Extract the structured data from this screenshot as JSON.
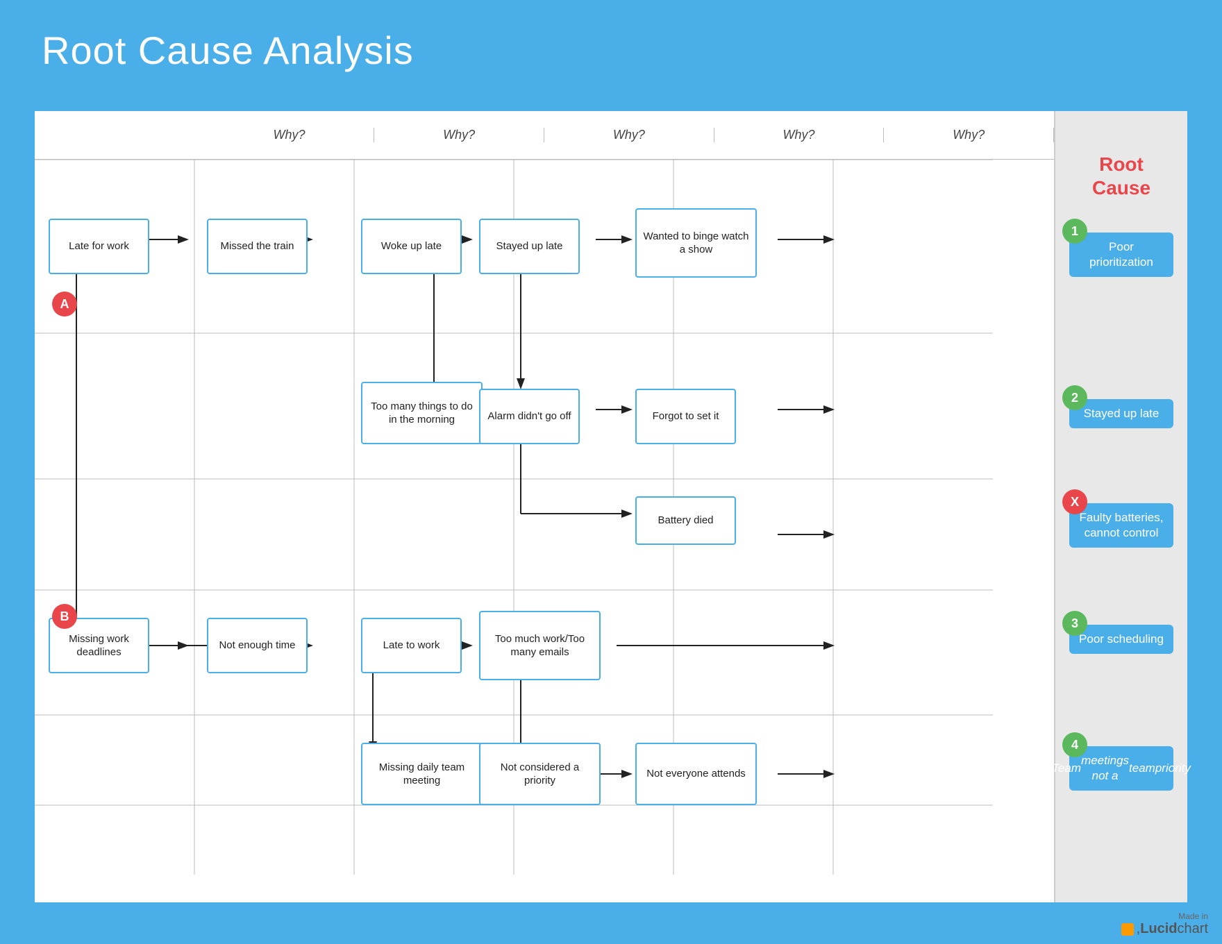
{
  "title": "Root Cause Analysis",
  "header": {
    "why_labels": [
      "Why?",
      "Why?",
      "Why?",
      "Why?",
      "Why?"
    ]
  },
  "row_labels": [
    {
      "id": "A",
      "color": "red"
    },
    {
      "id": "B",
      "color": "red"
    }
  ],
  "boxes": [
    {
      "id": "late-for-work",
      "text": "Late for work",
      "col": 0,
      "row": "A-main"
    },
    {
      "id": "missed-train",
      "text": "Missed the train",
      "col": 1,
      "row": "A-main"
    },
    {
      "id": "woke-up-late",
      "text": "Woke up late",
      "col": 2,
      "row": "A-main"
    },
    {
      "id": "stayed-up-late-box",
      "text": "Stayed up late",
      "col": 3,
      "row": "A-main"
    },
    {
      "id": "wanted-binge",
      "text": "Wanted to binge watch a show",
      "col": 4,
      "row": "A-main"
    },
    {
      "id": "too-many-morning",
      "text": "Too many things to do in the morning",
      "col": 2,
      "row": "A-sub"
    },
    {
      "id": "alarm-didnt",
      "text": "Alarm didn't go off",
      "col": 3,
      "row": "A-sub"
    },
    {
      "id": "forgot-set",
      "text": "Forgot to set it",
      "col": 4,
      "row": "A-sub"
    },
    {
      "id": "battery-died",
      "text": "Battery died",
      "col": 4,
      "row": "X"
    },
    {
      "id": "missing-deadlines",
      "text": "Missing work deadlines",
      "col": 0,
      "row": "B-main"
    },
    {
      "id": "not-enough-time",
      "text": "Not enough time",
      "col": 1,
      "row": "B-main"
    },
    {
      "id": "late-to-work",
      "text": "Late to work",
      "col": 2,
      "row": "B-main"
    },
    {
      "id": "too-much-work",
      "text": "Too much work/Too many emails",
      "col": 3,
      "row": "B-main"
    },
    {
      "id": "missing-meeting",
      "text": "Missing daily team meeting",
      "col": 2,
      "row": "B-sub"
    },
    {
      "id": "not-considered",
      "text": "Not considered a priority",
      "col": 3,
      "row": "B-sub"
    },
    {
      "id": "not-everyone",
      "text": "Not everyone attends",
      "col": 4,
      "row": "B-sub"
    }
  ],
  "root_causes": [
    {
      "id": "1",
      "label": "Poor prioritization",
      "type": "green",
      "italic": false
    },
    {
      "id": "2",
      "label": "Stayed up late",
      "type": "green",
      "italic": false
    },
    {
      "id": "X",
      "label": "Faulty batteries, cannot control",
      "type": "red",
      "italic": false
    },
    {
      "id": "3",
      "label": "Poor scheduling",
      "type": "green",
      "italic": false
    },
    {
      "id": "4",
      "label": "Team meetings not a team priority",
      "type": "green",
      "italic": true
    }
  ],
  "watermark": {
    "made_in": "Made in",
    "brand": "Lucidchart"
  }
}
